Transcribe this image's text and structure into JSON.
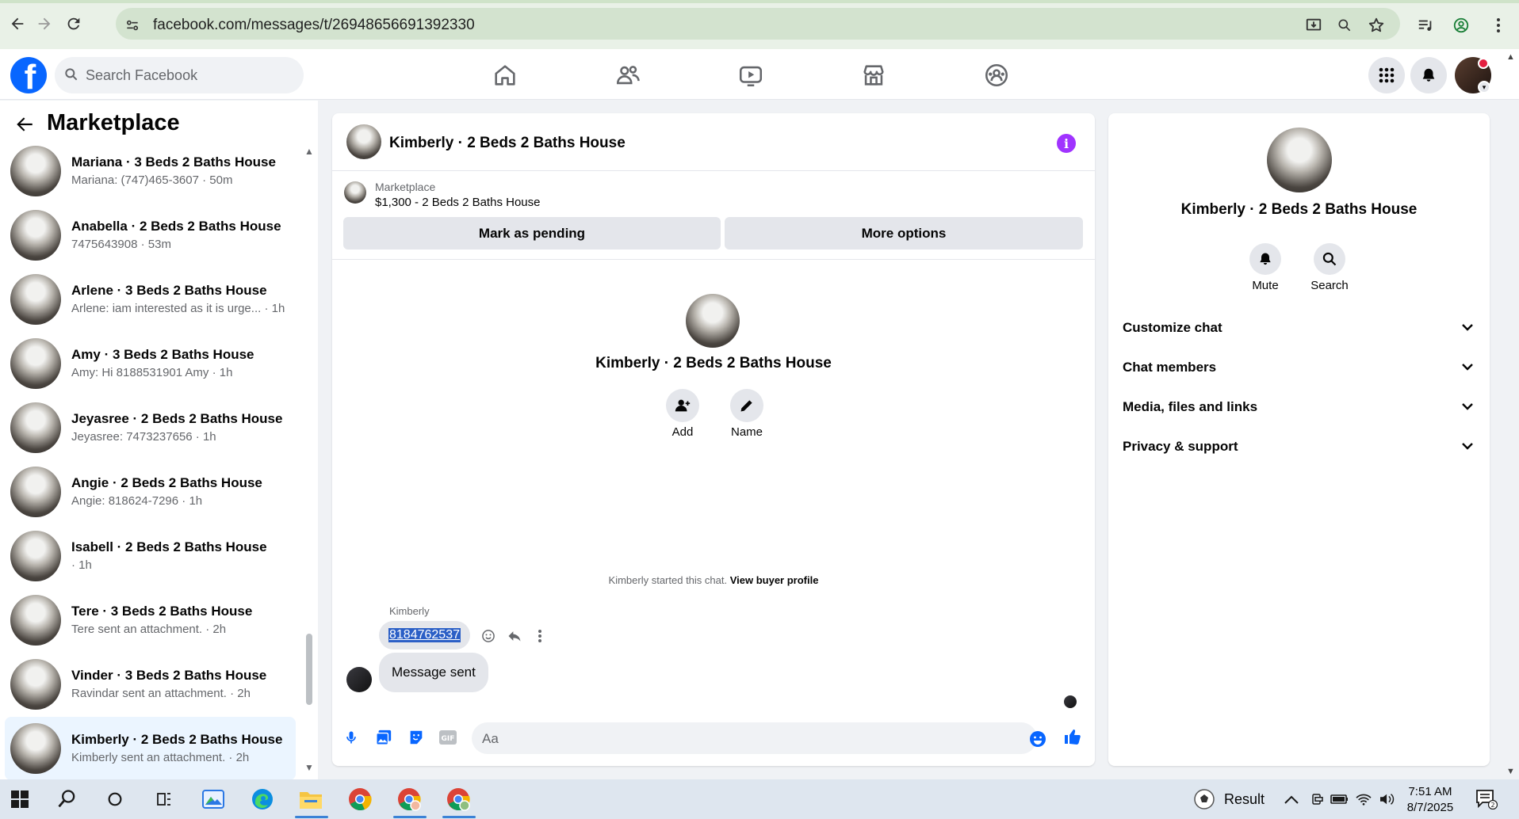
{
  "browser": {
    "url": "facebook.com/messages/t/26948656691392330"
  },
  "header": {
    "logo_letter": "f",
    "search_placeholder": "Search Facebook",
    "nav_tabs": [
      "home-icon",
      "friends-icon",
      "video-icon",
      "marketplace-icon",
      "groups-icon"
    ]
  },
  "sidebar": {
    "title": "Marketplace",
    "conversations": [
      {
        "title": "Mariana · 3 Beds 2 Baths House",
        "subtitle": "Mariana: (747)465-3607 · 50m"
      },
      {
        "title": "Anabella · 2 Beds 2 Baths House",
        "subtitle": "7475643908 · 53m"
      },
      {
        "title": "Arlene · 3 Beds 2 Baths House",
        "subtitle": "Arlene: iam interested as it is urge...  · 1h"
      },
      {
        "title": "Amy · 3 Beds 2 Baths House",
        "subtitle": "Amy: Hi 8188531901 Amy · 1h"
      },
      {
        "title": "Jeyasree · 2 Beds 2 Baths House",
        "subtitle": "Jeyasree: 7473237656 · 1h"
      },
      {
        "title": "Angie · 2 Beds 2 Baths House",
        "subtitle": "Angie: 818624-7296 · 1h"
      },
      {
        "title": "Isabell · 2 Beds 2 Baths House",
        "subtitle": " · 1h"
      },
      {
        "title": "Tere · 3 Beds 2 Baths House",
        "subtitle": "Tere sent an attachment. · 2h"
      },
      {
        "title": "Vinder · 3 Beds 2 Baths House",
        "subtitle": "Ravindar sent an attachment. · 2h"
      },
      {
        "title": "Kimberly · 2 Beds 2 Baths House",
        "subtitle": "Kimberly sent an attachment. · 2h"
      }
    ]
  },
  "chat": {
    "title": "Kimberly · 2 Beds 2 Baths House",
    "marketplace_label": "Marketplace",
    "listing": "$1,300 - 2 Beds 2 Baths House",
    "mark_pending": "Mark as pending",
    "more_options": "More options",
    "center_title": "Kimberly · 2 Beds 2 Baths House",
    "add_label": "Add",
    "name_label": "Name",
    "started_text": "Kimberly started this chat.",
    "view_profile": "View buyer profile",
    "sender_name": "Kimberly",
    "message_number": "8184762537",
    "message_sent": "Message sent",
    "composer_placeholder": "Aa"
  },
  "right_panel": {
    "title": "Kimberly · 2 Beds 2 Baths House",
    "mute_label": "Mute",
    "search_label": "Search",
    "sections": [
      "Customize chat",
      "Chat members",
      "Media, files and links",
      "Privacy & support"
    ]
  },
  "taskbar": {
    "weather_label": "Result",
    "time": "7:51 AM",
    "date": "8/7/2025",
    "notification_count": "2"
  },
  "colors": {
    "brand": "#0866ff",
    "info_purple": "#a033ff",
    "active_row": "#ebf5ff"
  }
}
